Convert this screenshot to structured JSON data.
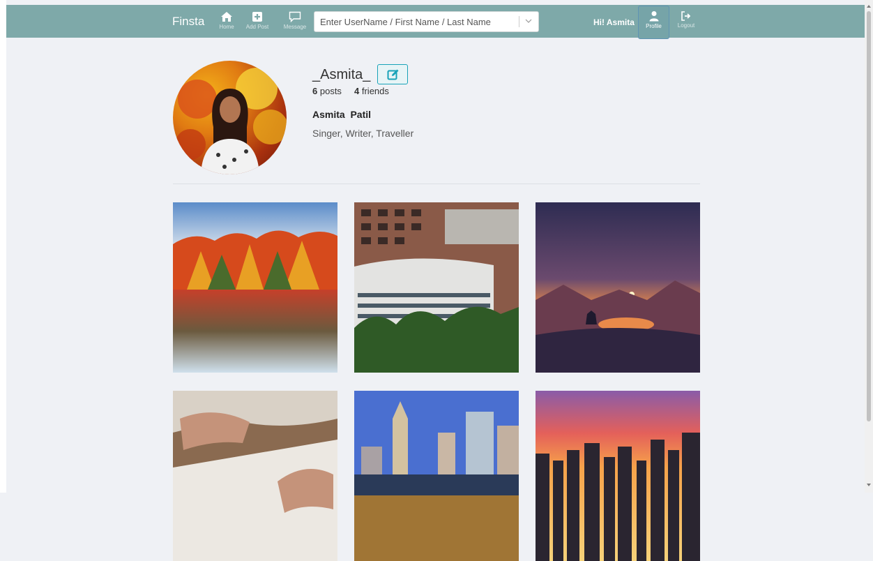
{
  "navbar": {
    "brand": "Finsta",
    "items": [
      {
        "label": "Home",
        "icon": "home-icon"
      },
      {
        "label": "Add Post",
        "icon": "plus-square-icon"
      },
      {
        "label": "Message",
        "icon": "message-icon"
      },
      {
        "label": "Profile",
        "icon": "user-icon"
      },
      {
        "label": "Logout",
        "icon": "logout-icon"
      }
    ],
    "search": {
      "placeholder": "Enter UserName / First Name / Last Name"
    },
    "greeting": "Hi! Asmita",
    "colors": {
      "navbar_bg": "#7ea9a9",
      "accent": "#17a2b8"
    }
  },
  "profile": {
    "username": "_Asmita_",
    "posts_count": "6",
    "posts_label": "posts",
    "friends_count": "4",
    "friends_label": "friends",
    "full_name": "Asmita  Patil",
    "bio": "Singer, Writer, Traveller"
  },
  "posts": [
    {
      "subject": "autumn forest lake reflection"
    },
    {
      "subject": "northeastern university building"
    },
    {
      "subject": "sunset mountains with deer"
    },
    {
      "subject": "hand writing on paper"
    },
    {
      "subject": "city skyline daytime"
    },
    {
      "subject": "city skyline at sunset"
    }
  ]
}
